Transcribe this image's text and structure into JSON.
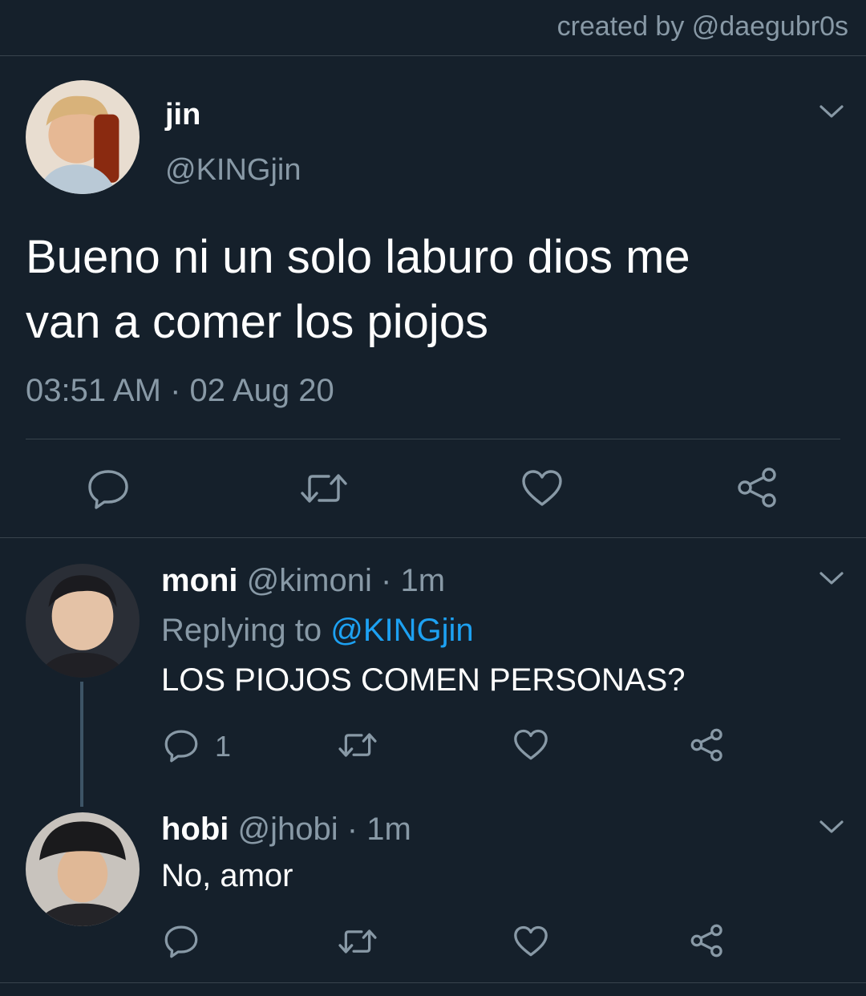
{
  "credit": "created by @daegubr0s",
  "main_tweet": {
    "display_name": "jin",
    "handle": "@KINGjin",
    "text_line1": "Bueno ni un solo laburo dios me",
    "text_line2": "van a comer los piojos",
    "timestamp": "03:51 AM · 02 Aug 20"
  },
  "replies": [
    {
      "display_name": "moni",
      "handle": "@kimoni",
      "separator": "·",
      "time": "1m",
      "replying_prefix": "Replying to",
      "replying_to": "@KINGjin",
      "text": "LOS PIOJOS COMEN PERSONAS?",
      "reply_count": "1"
    },
    {
      "display_name": "hobi",
      "handle": "@jhobi",
      "separator": "·",
      "time": "1m",
      "text": "No, amor"
    }
  ],
  "icons": {
    "reply": "reply-bubble-icon",
    "retweet": "retweet-icon",
    "like": "heart-icon",
    "share": "share-icon",
    "menu": "chevron-down-icon"
  },
  "colors": {
    "background": "#15202b",
    "divider": "#38444d",
    "secondary_text": "#8899a6",
    "link": "#1da1f2"
  }
}
